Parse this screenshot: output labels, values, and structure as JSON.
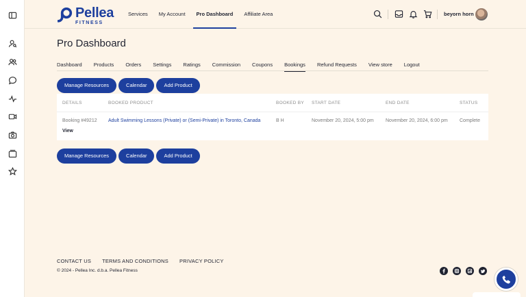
{
  "rail": {
    "icons": [
      "sidebar-toggle-icon",
      "user-search-icon",
      "users-icon",
      "chat-icon",
      "activity-icon",
      "video-icon",
      "camera-icon",
      "media-icon",
      "star-icon"
    ]
  },
  "brand": {
    "name": "Pellea",
    "tagline": "FITNESS",
    "color": "#1d3f9e"
  },
  "topnav": {
    "items": [
      {
        "label": "Services"
      },
      {
        "label": "My Account"
      },
      {
        "label": "Pro Dashboard",
        "active": true
      },
      {
        "label": "Affiliate Area"
      }
    ]
  },
  "header": {
    "username": "beyorn horn"
  },
  "page": {
    "title": "Pro Dashboard"
  },
  "subnav": {
    "items": [
      {
        "label": "Dashboard"
      },
      {
        "label": "Products"
      },
      {
        "label": "Orders"
      },
      {
        "label": "Settings"
      },
      {
        "label": "Ratings"
      },
      {
        "label": "Commission"
      },
      {
        "label": "Coupons"
      },
      {
        "label": "Bookings",
        "active": true
      },
      {
        "label": "Refund Requests"
      },
      {
        "label": "View store"
      },
      {
        "label": "Logout"
      }
    ]
  },
  "actions": {
    "manage_resources": "Manage Resources",
    "calendar": "Calendar",
    "add_product": "Add Product"
  },
  "table": {
    "columns": [
      "DETAILS",
      "BOOKED PRODUCT",
      "BOOKED BY",
      "START DATE",
      "END DATE",
      "STATUS"
    ],
    "rows": [
      {
        "details": "Booking #49212",
        "view": "View",
        "product": "Adult Swimming Lessons (Private) or (Semi-Private) in Toronto, Canada",
        "booked_by": "B H",
        "start": "November 20, 2024, 5:00 pm",
        "end": "November 20, 2024, 6:00 pm",
        "status": "Complete"
      }
    ]
  },
  "footer": {
    "links": [
      "CONTACT US",
      "TERMS AND CONDITIONS",
      "PRIVACY POLICY"
    ],
    "copyright": "© 2024 - Pellea Inc. d.b.a. Pellea Fitness",
    "social": [
      "facebook-icon",
      "instagram-icon",
      "linkedin-icon",
      "twitter-icon"
    ]
  }
}
